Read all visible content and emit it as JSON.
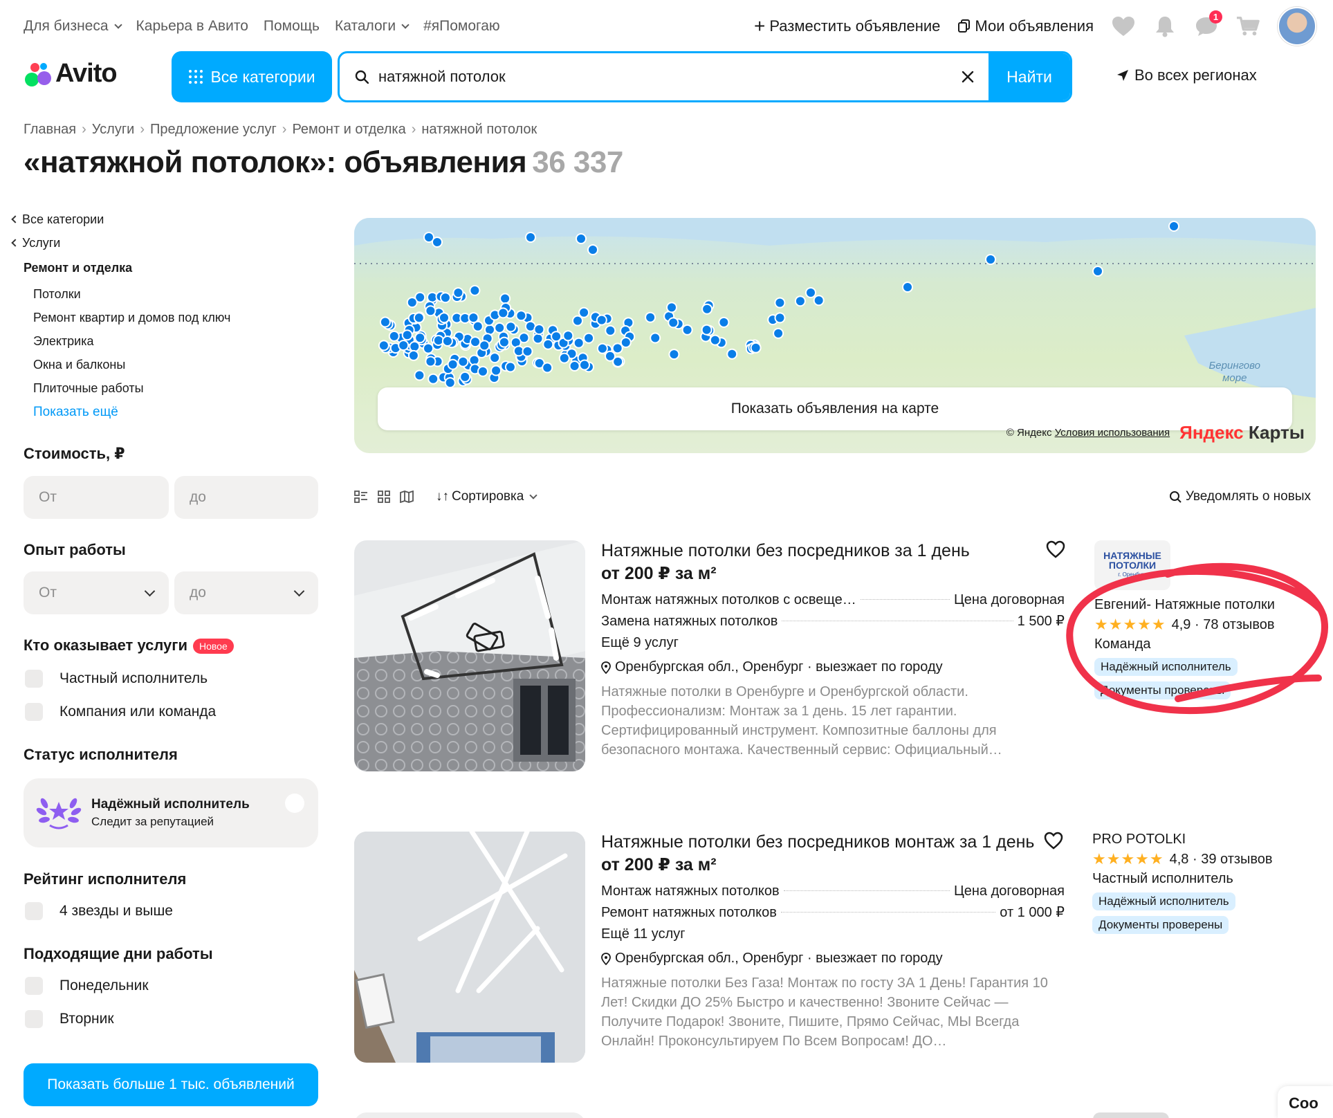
{
  "topnav": {
    "business": "Для бизнеса",
    "career": "Карьера в Авито",
    "help": "Помощь",
    "catalogs": "Каталоги",
    "help_tag": "#яПомогаю",
    "post_ad": "Разместить объявление",
    "my_ads": "Мои объявления",
    "messages_badge": "1"
  },
  "header": {
    "logo": "Avito",
    "all_categories": "Все категории",
    "search_value": "натяжной потолок",
    "search_button": "Найти",
    "region": "Во всех регионах"
  },
  "breadcrumbs": [
    "Главная",
    "Услуги",
    "Предложение услуг",
    "Ремонт и отделка",
    "натяжной потолок"
  ],
  "page": {
    "title": "«натяжной потолок»: объявления",
    "count": "36 337"
  },
  "sidebar": {
    "back_all": "Все категории",
    "back_services": "Услуги",
    "group": "Ремонт и отделка",
    "subcats": [
      "Потолки",
      "Ремонт квартир и домов под ключ",
      "Электрика",
      "Окна и балконы",
      "Плиточные работы"
    ],
    "show_more": "Показать ещё",
    "price_title": "Стоимость, ₽",
    "price_from": "От",
    "price_to": "до",
    "exp_title": "Опыт работы",
    "exp_from": "От",
    "exp_to": "до",
    "who_title": "Кто оказывает услуги",
    "new_badge": "Новое",
    "who_options": [
      "Частный исполнитель",
      "Компания или команда"
    ],
    "status_title": "Статус исполнителя",
    "status_card_title": "Надёжный исполнитель",
    "status_card_sub": "Следит за репутацией",
    "rating_title": "Рейтинг исполнителя",
    "rating_option": "4 звезды и выше",
    "days_title": "Подходящие дни работы",
    "days": [
      "Понедельник",
      "Вторник"
    ],
    "show_more_btn": "Показать больше 1 тыс. объявлений"
  },
  "map": {
    "show_on_map": "Показать объявления на карте",
    "copyright": "© Яндекс",
    "terms": "Условия использования",
    "brand_a": "Яндекс",
    "brand_b": "Карты",
    "sea_label_1": "Берингово",
    "sea_label_2": "море"
  },
  "toolbar": {
    "sort": "Сортировка",
    "notify": "Уведомлять о новых"
  },
  "listings": [
    {
      "title": "Натяжные потолки без посредников за 1 день",
      "price": "от 200 ₽ за м²",
      "services": [
        {
          "name": "Монтаж натяжных потолков с освеще…",
          "price": "Цена договорная"
        },
        {
          "name": "Замена натяжных потолков",
          "price": "1 500 ₽"
        }
      ],
      "more_services": "Ещё 9 услуг",
      "location": "Оренбургская обл., Оренбург · выезжает по городу",
      "description": "Натяжные потолки в Оренбурге и Оренбургской области. Профессионализм: Монтаж за 1 день. 15 лет гарантии. Сертифицированный инструмент. Композитные баллоны для безопасного монтажа. Качественный сервис: Официальный…",
      "seller_logo_1": "НАТЯЖНЫЕ",
      "seller_logo_2": "ПОТОЛКИ",
      "seller_logo_3": "г. Оренбург",
      "seller": "Евгений- Натяжные потолки",
      "rating": "4,9 · 78 отзывов",
      "seller_type": "Команда",
      "badges": [
        "Надёжный исполнитель",
        "Документы проверены"
      ]
    },
    {
      "title": "Натяжные потолки без посредников монтаж за 1 день",
      "price": "от 200 ₽ за м²",
      "services": [
        {
          "name": "Монтаж натяжных потолков",
          "price": "Цена договорная"
        },
        {
          "name": "Ремонт натяжных потолков",
          "price": "от 1 000 ₽"
        }
      ],
      "more_services": "Ещё 11 услуг",
      "location": "Оренбургская обл., Оренбург · выезжает по городу",
      "description": "Натяжные потолки Без Газа! Монтаж по госту ЗА 1 День! Гарантия 10 Лет! Скидки ДО 25% Быстро и качественно! Звоните Сейчас — Получите Подарок! Звоните, Пишите, Прямо Сейчас, МЫ Всегда Онлайн! Проконсультируем По Всем Вопросам! ДО…",
      "seller": "PRO POTOLKI",
      "rating": "4,8 · 39 отзывов",
      "seller_type": "Частный исполнитель",
      "badges": [
        "Надёжный исполнитель",
        "Документы проверены"
      ]
    }
  ],
  "cookie_text": "Coo",
  "colors": {
    "accent": "#00aaff",
    "link": "#0099f7",
    "badge_red": "#ff3b4f",
    "map_point": "#0a7ee8",
    "annotation_red": "#f0324a",
    "stars": "#ffb021"
  }
}
